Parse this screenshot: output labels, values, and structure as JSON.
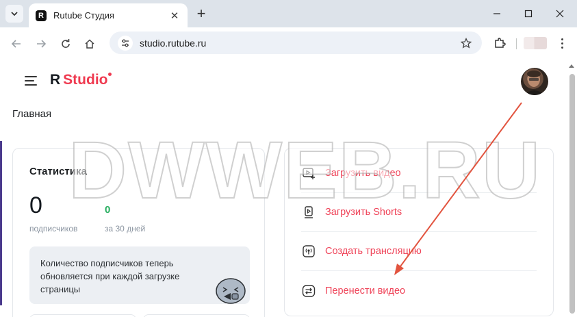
{
  "browser": {
    "tab_title": "Rutube Студия",
    "tab_favicon_letter": "R",
    "url": "studio.rutube.ru"
  },
  "header": {
    "logo_letter": "R",
    "logo_text": "Studio"
  },
  "page": {
    "title": "Главная"
  },
  "stats": {
    "title": "Статистика",
    "subscribers_value": "0",
    "subscribers_label": "подписчиков",
    "delta_value": "0",
    "delta_label": "за 30 дней",
    "info_text": "Количество подписчиков теперь обновляется при каждой загрузке страницы"
  },
  "actions": [
    {
      "label": "Загрузить видео",
      "icon": "upload-video-icon"
    },
    {
      "label": "Загрузить Shorts",
      "icon": "upload-shorts-icon"
    },
    {
      "label": "Создать трансляцию",
      "icon": "broadcast-icon"
    },
    {
      "label": "Перенести видео",
      "icon": "transfer-icon"
    }
  ],
  "watermark": "DWWEB.RU",
  "colors": {
    "brand_red": "#ef3a50",
    "positive_green": "#27ae60",
    "annotation_arrow": "#e2543f"
  }
}
